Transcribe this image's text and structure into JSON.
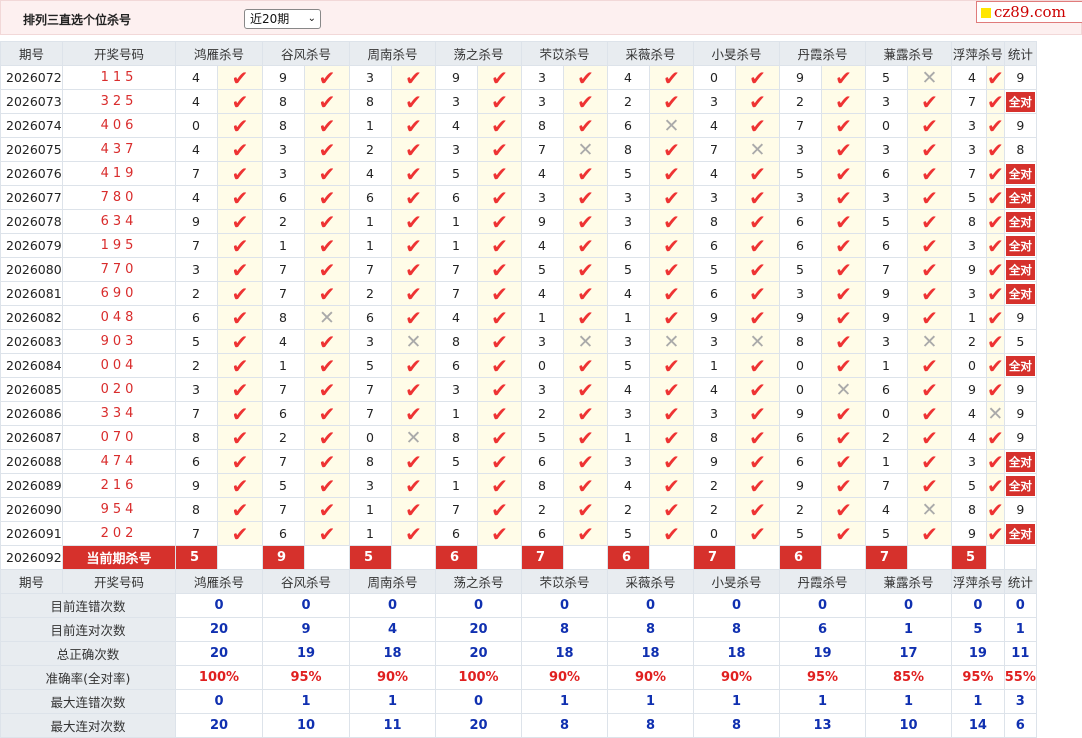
{
  "header": {
    "title": "排列三直选个位杀号",
    "period_select": "近20期",
    "logo": "cz89.com"
  },
  "columns": {
    "period": "期号",
    "draw": "开奖号码",
    "experts": [
      "鸿雁杀号",
      "谷风杀号",
      "周南杀号",
      "荡之杀号",
      "芣苡杀号",
      "采薇杀号",
      "小旻杀号",
      "丹霞杀号",
      "蒹露杀号",
      "浮萍杀号"
    ],
    "stat": "统计"
  },
  "all_right_label": "全对",
  "rows": [
    {
      "period": "2026072",
      "draw": "115",
      "kills": [
        4,
        9,
        3,
        9,
        3,
        4,
        0,
        9,
        5,
        4
      ],
      "ok": [
        1,
        1,
        1,
        1,
        1,
        1,
        1,
        1,
        0,
        1
      ],
      "stat": "9"
    },
    {
      "period": "2026073",
      "draw": "325",
      "kills": [
        4,
        8,
        8,
        3,
        3,
        2,
        3,
        2,
        3,
        7
      ],
      "ok": [
        1,
        1,
        1,
        1,
        1,
        1,
        1,
        1,
        1,
        1
      ],
      "stat": "全对"
    },
    {
      "period": "2026074",
      "draw": "406",
      "kills": [
        0,
        8,
        1,
        4,
        8,
        6,
        4,
        7,
        0,
        3
      ],
      "ok": [
        1,
        1,
        1,
        1,
        1,
        0,
        1,
        1,
        1,
        1
      ],
      "stat": "9"
    },
    {
      "period": "2026075",
      "draw": "437",
      "kills": [
        4,
        3,
        2,
        3,
        7,
        8,
        7,
        3,
        3,
        3
      ],
      "ok": [
        1,
        1,
        1,
        1,
        0,
        1,
        0,
        1,
        1,
        1
      ],
      "stat": "8"
    },
    {
      "period": "2026076",
      "draw": "419",
      "kills": [
        7,
        3,
        4,
        5,
        4,
        5,
        4,
        5,
        6,
        7
      ],
      "ok": [
        1,
        1,
        1,
        1,
        1,
        1,
        1,
        1,
        1,
        1
      ],
      "stat": "全对"
    },
    {
      "period": "2026077",
      "draw": "780",
      "kills": [
        4,
        6,
        6,
        6,
        3,
        3,
        3,
        3,
        3,
        5
      ],
      "ok": [
        1,
        1,
        1,
        1,
        1,
        1,
        1,
        1,
        1,
        1
      ],
      "stat": "全对"
    },
    {
      "period": "2026078",
      "draw": "634",
      "kills": [
        9,
        2,
        1,
        1,
        9,
        3,
        8,
        6,
        5,
        8
      ],
      "ok": [
        1,
        1,
        1,
        1,
        1,
        1,
        1,
        1,
        1,
        1
      ],
      "stat": "全对"
    },
    {
      "period": "2026079",
      "draw": "195",
      "kills": [
        7,
        1,
        1,
        1,
        4,
        6,
        6,
        6,
        6,
        3
      ],
      "ok": [
        1,
        1,
        1,
        1,
        1,
        1,
        1,
        1,
        1,
        1
      ],
      "stat": "全对"
    },
    {
      "period": "2026080",
      "draw": "770",
      "kills": [
        3,
        7,
        7,
        7,
        5,
        5,
        5,
        5,
        7,
        9
      ],
      "ok": [
        1,
        1,
        1,
        1,
        1,
        1,
        1,
        1,
        1,
        1
      ],
      "stat": "全对"
    },
    {
      "period": "2026081",
      "draw": "690",
      "kills": [
        2,
        7,
        2,
        7,
        4,
        4,
        6,
        3,
        9,
        3
      ],
      "ok": [
        1,
        1,
        1,
        1,
        1,
        1,
        1,
        1,
        1,
        1
      ],
      "stat": "全对"
    },
    {
      "period": "2026082",
      "draw": "048",
      "kills": [
        6,
        8,
        6,
        4,
        1,
        1,
        9,
        9,
        9,
        1
      ],
      "ok": [
        1,
        0,
        1,
        1,
        1,
        1,
        1,
        1,
        1,
        1
      ],
      "stat": "9"
    },
    {
      "period": "2026083",
      "draw": "903",
      "kills": [
        5,
        4,
        3,
        8,
        3,
        3,
        3,
        8,
        3,
        2
      ],
      "ok": [
        1,
        1,
        0,
        1,
        0,
        0,
        0,
        1,
        0,
        1
      ],
      "stat": "5"
    },
    {
      "period": "2026084",
      "draw": "004",
      "kills": [
        2,
        1,
        5,
        6,
        0,
        5,
        1,
        0,
        1,
        0
      ],
      "ok": [
        1,
        1,
        1,
        1,
        1,
        1,
        1,
        1,
        1,
        1
      ],
      "stat": "全对"
    },
    {
      "period": "2026085",
      "draw": "020",
      "kills": [
        3,
        7,
        7,
        3,
        3,
        4,
        4,
        0,
        6,
        9
      ],
      "ok": [
        1,
        1,
        1,
        1,
        1,
        1,
        1,
        0,
        1,
        1
      ],
      "stat": "9"
    },
    {
      "period": "2026086",
      "draw": "334",
      "kills": [
        7,
        6,
        7,
        1,
        2,
        3,
        3,
        9,
        0,
        4
      ],
      "ok": [
        1,
        1,
        1,
        1,
        1,
        1,
        1,
        1,
        1,
        0
      ],
      "stat": "9"
    },
    {
      "period": "2026087",
      "draw": "070",
      "kills": [
        8,
        2,
        0,
        8,
        5,
        1,
        8,
        6,
        2,
        4
      ],
      "ok": [
        1,
        1,
        0,
        1,
        1,
        1,
        1,
        1,
        1,
        1
      ],
      "stat": "9"
    },
    {
      "period": "2026088",
      "draw": "474",
      "kills": [
        6,
        7,
        8,
        5,
        6,
        3,
        9,
        6,
        1,
        3
      ],
      "ok": [
        1,
        1,
        1,
        1,
        1,
        1,
        1,
        1,
        1,
        1
      ],
      "stat": "全对"
    },
    {
      "period": "2026089",
      "draw": "216",
      "kills": [
        9,
        5,
        3,
        1,
        8,
        4,
        2,
        9,
        7,
        5
      ],
      "ok": [
        1,
        1,
        1,
        1,
        1,
        1,
        1,
        1,
        1,
        1
      ],
      "stat": "全对"
    },
    {
      "period": "2026090",
      "draw": "954",
      "kills": [
        8,
        7,
        1,
        7,
        2,
        2,
        2,
        2,
        4,
        8
      ],
      "ok": [
        1,
        1,
        1,
        1,
        1,
        1,
        1,
        1,
        0,
        1
      ],
      "stat": "9"
    },
    {
      "period": "2026091",
      "draw": "202",
      "kills": [
        7,
        6,
        1,
        6,
        6,
        5,
        0,
        5,
        5,
        9
      ],
      "ok": [
        1,
        1,
        1,
        1,
        1,
        1,
        1,
        1,
        1,
        1
      ],
      "stat": "全对"
    }
  ],
  "current": {
    "period": "2026092",
    "label": "当前期杀号",
    "kills": [
      5,
      9,
      5,
      6,
      7,
      6,
      7,
      6,
      7,
      5
    ]
  },
  "stats": [
    {
      "label": "目前连错次数",
      "values": [
        "0",
        "0",
        "0",
        "0",
        "0",
        "0",
        "0",
        "0",
        "0",
        "0"
      ],
      "stat": "0",
      "red": false
    },
    {
      "label": "目前连对次数",
      "values": [
        "20",
        "9",
        "4",
        "20",
        "8",
        "8",
        "8",
        "6",
        "1",
        "5"
      ],
      "stat": "1",
      "red": false
    },
    {
      "label": "总正确次数",
      "values": [
        "20",
        "19",
        "18",
        "20",
        "18",
        "18",
        "18",
        "19",
        "17",
        "19"
      ],
      "stat": "11",
      "red": false
    },
    {
      "label": "准确率(全对率)",
      "values": [
        "100%",
        "95%",
        "90%",
        "100%",
        "90%",
        "90%",
        "90%",
        "95%",
        "85%",
        "95%"
      ],
      "stat": "55%",
      "red": true
    },
    {
      "label": "最大连错次数",
      "values": [
        "0",
        "1",
        "1",
        "0",
        "1",
        "1",
        "1",
        "1",
        "1",
        "1"
      ],
      "stat": "3",
      "red": false
    },
    {
      "label": "最大连对次数",
      "values": [
        "20",
        "10",
        "11",
        "20",
        "8",
        "8",
        "8",
        "13",
        "10",
        "14"
      ],
      "stat": "6",
      "red": false
    }
  ]
}
